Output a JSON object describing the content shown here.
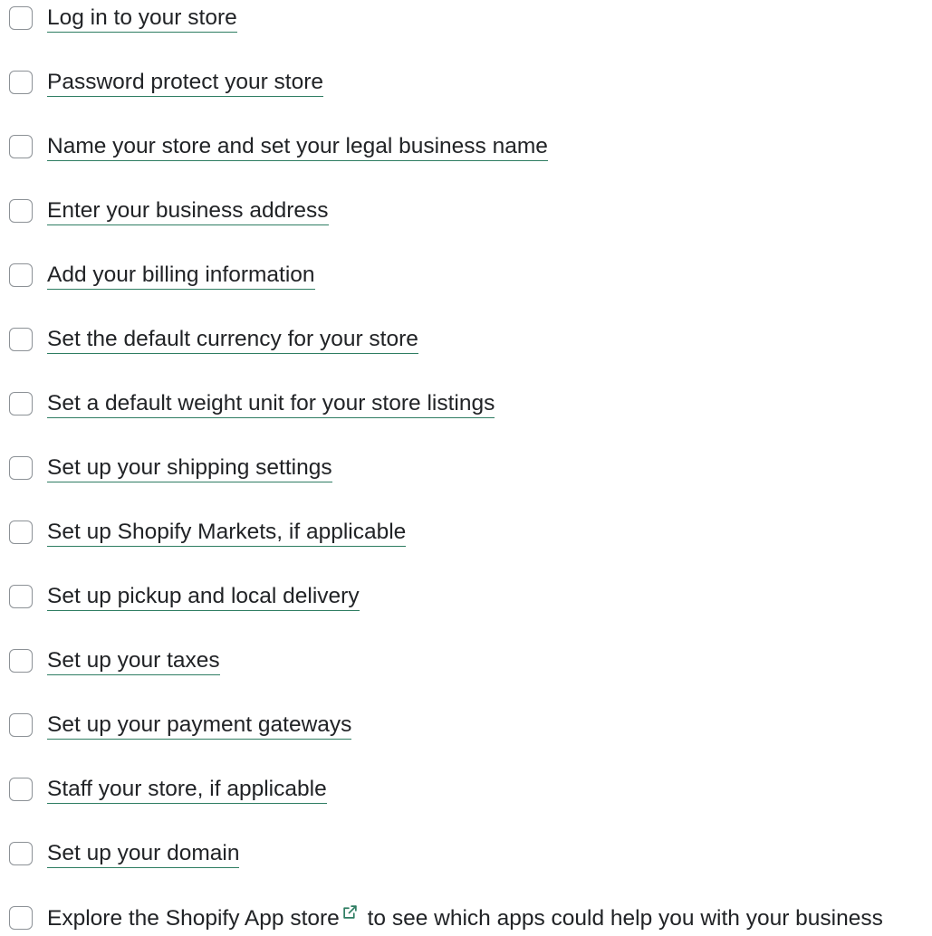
{
  "checklist": {
    "items": [
      {
        "label": "Log in to your store"
      },
      {
        "label": "Password protect your store"
      },
      {
        "label": "Name your store and set your legal business name"
      },
      {
        "label": "Enter your business address"
      },
      {
        "label": "Add your billing information"
      },
      {
        "label": "Set the default currency for your store"
      },
      {
        "label": "Set a default weight unit for your store listings"
      },
      {
        "label": "Set up your shipping settings"
      },
      {
        "label": "Set up Shopify Markets, if applicable"
      },
      {
        "label": "Set up pickup and local delivery"
      },
      {
        "label": "Set up your taxes"
      },
      {
        "label": "Set up your payment gateways"
      },
      {
        "label": "Staff your store, if applicable"
      },
      {
        "label": "Set up your domain"
      }
    ],
    "last_item": {
      "prefix": "Explore the ",
      "link_label": "Shopify App store",
      "link_icon": "external-link-icon",
      "suffix": " to see which apps could help you with your business"
    }
  },
  "colors": {
    "text": "#212326",
    "link_underline": "#2e7d62",
    "checkbox_border": "#8c9196",
    "external_icon": "#2e7d62"
  }
}
